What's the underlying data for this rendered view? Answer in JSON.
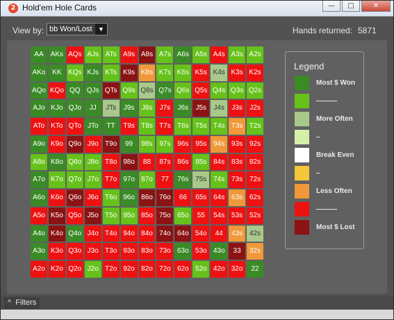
{
  "window": {
    "title": "Hold'em Hole Cards",
    "icon_glyph": "2",
    "controls": {
      "minimize": "—",
      "maximize": "□",
      "close": "✕"
    }
  },
  "toolbar": {
    "view_by_label": "View by:",
    "view_by_value": "bb Won/Lost",
    "hands_returned_label": "Hands returned:",
    "hands_returned_value": "5871"
  },
  "palette": {
    "dg": "#3a8b26",
    "lg": "#66c21a",
    "pg": "#a8c98a",
    "vp": "#d4f0a8",
    "w": "#ffffff",
    "y": "#f5c637",
    "o": "#f0983a",
    "r": "#ee1111",
    "dr": "#8c1313"
  },
  "grid": {
    "rows": [
      [
        {
          "t": "AA",
          "c": "dg"
        },
        {
          "t": "AKs",
          "c": "dg"
        },
        {
          "t": "AQs",
          "c": "r"
        },
        {
          "t": "AJs",
          "c": "lg"
        },
        {
          "t": "ATs",
          "c": "lg"
        },
        {
          "t": "A9s",
          "c": "r"
        },
        {
          "t": "A8s",
          "c": "dr"
        },
        {
          "t": "A7s",
          "c": "lg"
        },
        {
          "t": "A6s",
          "c": "dg"
        },
        {
          "t": "A5s",
          "c": "lg"
        },
        {
          "t": "A4s",
          "c": "r"
        },
        {
          "t": "A3s",
          "c": "lg"
        },
        {
          "t": "A2s",
          "c": "lg"
        }
      ],
      [
        {
          "t": "AKo",
          "c": "dg"
        },
        {
          "t": "KK",
          "c": "dg"
        },
        {
          "t": "KQs",
          "c": "lg"
        },
        {
          "t": "KJs",
          "c": "dg"
        },
        {
          "t": "KTs",
          "c": "lg"
        },
        {
          "t": "K9s",
          "c": "dr"
        },
        {
          "t": "K8s",
          "c": "o"
        },
        {
          "t": "K7s",
          "c": "lg"
        },
        {
          "t": "K6s",
          "c": "lg"
        },
        {
          "t": "K5s",
          "c": "r"
        },
        {
          "t": "K4s",
          "c": "pg"
        },
        {
          "t": "K3s",
          "c": "r"
        },
        {
          "t": "K2s",
          "c": "r"
        }
      ],
      [
        {
          "t": "AQo",
          "c": "dg"
        },
        {
          "t": "KQo",
          "c": "r"
        },
        {
          "t": "QQ",
          "c": "dg"
        },
        {
          "t": "QJs",
          "c": "dg"
        },
        {
          "t": "QTs",
          "c": "dr"
        },
        {
          "t": "Q9s",
          "c": "lg"
        },
        {
          "t": "Q8s",
          "c": "pg"
        },
        {
          "t": "Q7s",
          "c": "dg"
        },
        {
          "t": "Q6s",
          "c": "lg"
        },
        {
          "t": "Q5s",
          "c": "r"
        },
        {
          "t": "Q4s",
          "c": "lg"
        },
        {
          "t": "Q3s",
          "c": "lg"
        },
        {
          "t": "Q2s",
          "c": "lg"
        }
      ],
      [
        {
          "t": "AJo",
          "c": "dg"
        },
        {
          "t": "KJo",
          "c": "dg"
        },
        {
          "t": "QJo",
          "c": "dg"
        },
        {
          "t": "JJ",
          "c": "dg"
        },
        {
          "t": "JTs",
          "c": "pg"
        },
        {
          "t": "J9s",
          "c": "dg"
        },
        {
          "t": "J8s",
          "c": "lg"
        },
        {
          "t": "J7s",
          "c": "r"
        },
        {
          "t": "J6s",
          "c": "dg"
        },
        {
          "t": "J5s",
          "c": "dr"
        },
        {
          "t": "J4s",
          "c": "pg"
        },
        {
          "t": "J3s",
          "c": "r"
        },
        {
          "t": "J2s",
          "c": "r"
        }
      ],
      [
        {
          "t": "ATo",
          "c": "r"
        },
        {
          "t": "KTo",
          "c": "r"
        },
        {
          "t": "QTo",
          "c": "r"
        },
        {
          "t": "JTo",
          "c": "dg"
        },
        {
          "t": "TT",
          "c": "dg"
        },
        {
          "t": "T9s",
          "c": "r"
        },
        {
          "t": "T8s",
          "c": "lg"
        },
        {
          "t": "T7s",
          "c": "r"
        },
        {
          "t": "T6s",
          "c": "lg"
        },
        {
          "t": "T5s",
          "c": "lg"
        },
        {
          "t": "T4s",
          "c": "lg"
        },
        {
          "t": "T3s",
          "c": "o"
        },
        {
          "t": "T2s",
          "c": "lg"
        }
      ],
      [
        {
          "t": "A9o",
          "c": "dg"
        },
        {
          "t": "K9o",
          "c": "r"
        },
        {
          "t": "Q9o",
          "c": "dr"
        },
        {
          "t": "J9o",
          "c": "r"
        },
        {
          "t": "T9o",
          "c": "dr"
        },
        {
          "t": "99",
          "c": "dg"
        },
        {
          "t": "98s",
          "c": "lg"
        },
        {
          "t": "97s",
          "c": "lg"
        },
        {
          "t": "96s",
          "c": "r"
        },
        {
          "t": "95s",
          "c": "r"
        },
        {
          "t": "94s",
          "c": "o"
        },
        {
          "t": "93s",
          "c": "r"
        },
        {
          "t": "92s",
          "c": "r"
        }
      ],
      [
        {
          "t": "A8o",
          "c": "lg"
        },
        {
          "t": "K8o",
          "c": "dg"
        },
        {
          "t": "Q8o",
          "c": "lg"
        },
        {
          "t": "J8o",
          "c": "lg"
        },
        {
          "t": "T8o",
          "c": "r"
        },
        {
          "t": "98o",
          "c": "dr"
        },
        {
          "t": "88",
          "c": "r"
        },
        {
          "t": "87s",
          "c": "r"
        },
        {
          "t": "86s",
          "c": "r"
        },
        {
          "t": "85s",
          "c": "lg"
        },
        {
          "t": "84s",
          "c": "r"
        },
        {
          "t": "83s",
          "c": "r"
        },
        {
          "t": "82s",
          "c": "r"
        }
      ],
      [
        {
          "t": "A7o",
          "c": "dg"
        },
        {
          "t": "K7o",
          "c": "lg"
        },
        {
          "t": "Q7o",
          "c": "lg"
        },
        {
          "t": "J7o",
          "c": "lg"
        },
        {
          "t": "T7o",
          "c": "r"
        },
        {
          "t": "97o",
          "c": "dg"
        },
        {
          "t": "87o",
          "c": "lg"
        },
        {
          "t": "77",
          "c": "r"
        },
        {
          "t": "76s",
          "c": "dg"
        },
        {
          "t": "75s",
          "c": "pg"
        },
        {
          "t": "74s",
          "c": "lg"
        },
        {
          "t": "73s",
          "c": "r"
        },
        {
          "t": "72s",
          "c": "r"
        }
      ],
      [
        {
          "t": "A6o",
          "c": "dg"
        },
        {
          "t": "K6o",
          "c": "r"
        },
        {
          "t": "Q6o",
          "c": "dr"
        },
        {
          "t": "J6o",
          "c": "r"
        },
        {
          "t": "T6o",
          "c": "lg"
        },
        {
          "t": "96o",
          "c": "dg"
        },
        {
          "t": "86o",
          "c": "dr"
        },
        {
          "t": "76o",
          "c": "dr"
        },
        {
          "t": "66",
          "c": "r"
        },
        {
          "t": "65s",
          "c": "r"
        },
        {
          "t": "64s",
          "c": "r"
        },
        {
          "t": "63s",
          "c": "o"
        },
        {
          "t": "62s",
          "c": "r"
        }
      ],
      [
        {
          "t": "A5o",
          "c": "r"
        },
        {
          "t": "K5o",
          "c": "dr"
        },
        {
          "t": "Q5o",
          "c": "r"
        },
        {
          "t": "J5o",
          "c": "dr"
        },
        {
          "t": "T5o",
          "c": "lg"
        },
        {
          "t": "95o",
          "c": "lg"
        },
        {
          "t": "85o",
          "c": "r"
        },
        {
          "t": "75o",
          "c": "dr"
        },
        {
          "t": "65o",
          "c": "lg"
        },
        {
          "t": "55",
          "c": "r"
        },
        {
          "t": "54s",
          "c": "r"
        },
        {
          "t": "53s",
          "c": "r"
        },
        {
          "t": "52s",
          "c": "r"
        }
      ],
      [
        {
          "t": "A4o",
          "c": "dg"
        },
        {
          "t": "K4o",
          "c": "dr"
        },
        {
          "t": "Q4o",
          "c": "dg"
        },
        {
          "t": "J4o",
          "c": "r"
        },
        {
          "t": "T4o",
          "c": "r"
        },
        {
          "t": "94o",
          "c": "r"
        },
        {
          "t": "84o",
          "c": "r"
        },
        {
          "t": "74o",
          "c": "dr"
        },
        {
          "t": "64o",
          "c": "dr"
        },
        {
          "t": "54o",
          "c": "r"
        },
        {
          "t": "44",
          "c": "r"
        },
        {
          "t": "43s",
          "c": "o"
        },
        {
          "t": "42s",
          "c": "pg"
        }
      ],
      [
        {
          "t": "A3o",
          "c": "dg"
        },
        {
          "t": "K3o",
          "c": "r"
        },
        {
          "t": "Q3o",
          "c": "r"
        },
        {
          "t": "J3o",
          "c": "r"
        },
        {
          "t": "T3o",
          "c": "r"
        },
        {
          "t": "93o",
          "c": "r"
        },
        {
          "t": "83o",
          "c": "r"
        },
        {
          "t": "73o",
          "c": "r"
        },
        {
          "t": "63o",
          "c": "dg"
        },
        {
          "t": "53o",
          "c": "r"
        },
        {
          "t": "43o",
          "c": "dg"
        },
        {
          "t": "33",
          "c": "dr"
        },
        {
          "t": "32s",
          "c": "o"
        }
      ],
      [
        {
          "t": "A2o",
          "c": "r"
        },
        {
          "t": "K2o",
          "c": "r"
        },
        {
          "t": "Q2o",
          "c": "r"
        },
        {
          "t": "J2o",
          "c": "lg"
        },
        {
          "t": "T2o",
          "c": "r"
        },
        {
          "t": "92o",
          "c": "r"
        },
        {
          "t": "82o",
          "c": "r"
        },
        {
          "t": "72o",
          "c": "r"
        },
        {
          "t": "62o",
          "c": "r"
        },
        {
          "t": "52o",
          "c": "lg"
        },
        {
          "t": "42o",
          "c": "r"
        },
        {
          "t": "32o",
          "c": "r"
        },
        {
          "t": "22",
          "c": "dg"
        }
      ]
    ]
  },
  "legend": {
    "title": "Legend",
    "items": [
      {
        "label": "Most $ Won",
        "c": "dg"
      },
      {
        "label": "———",
        "c": "lg"
      },
      {
        "label": "More Often",
        "c": "pg"
      },
      {
        "label": "–",
        "c": "vp"
      },
      {
        "label": "Break Even",
        "c": "w"
      },
      {
        "label": "–",
        "c": "y"
      },
      {
        "label": "Less Often",
        "c": "o"
      },
      {
        "label": "———",
        "c": "r"
      },
      {
        "label": "Most $ Lost",
        "c": "dr"
      }
    ]
  },
  "footer": {
    "filters_label": "Filters",
    "filters_chevron": "^"
  }
}
